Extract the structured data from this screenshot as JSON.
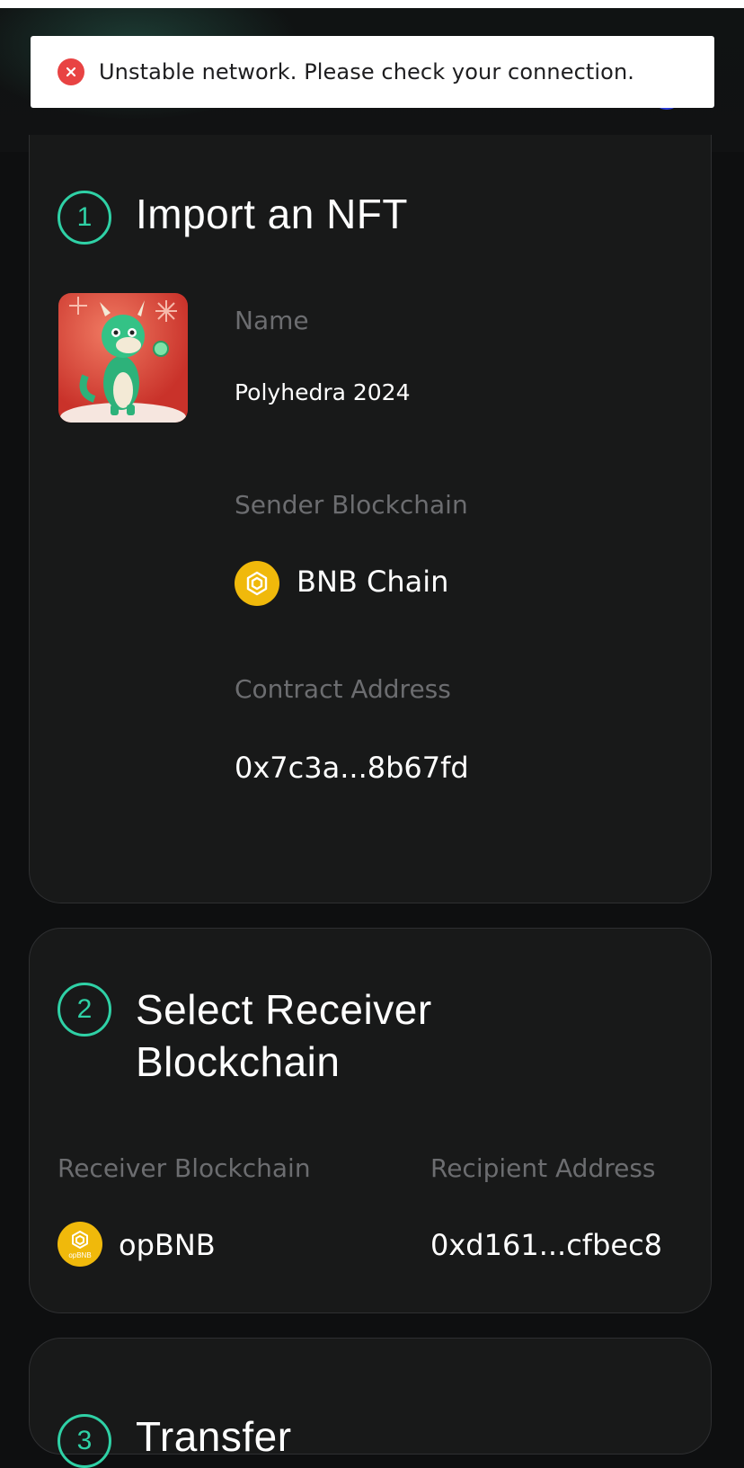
{
  "toast": {
    "message": "Unstable network. Please check your connection.",
    "icon": "close-circle-icon",
    "color": "#e84343"
  },
  "step1": {
    "number": "1",
    "title": "Import an NFT",
    "name_label": "Name",
    "name_value": "Polyhedra 2024",
    "sender_label": "Sender Blockchain",
    "sender_value": "BNB Chain",
    "contract_label": "Contract Address",
    "contract_value": "0x7c3a...8b67fd"
  },
  "step2": {
    "number": "2",
    "title_line1": "Select Receiver",
    "title_line2": "Blockchain",
    "receiver_label": "Receiver Blockchain",
    "receiver_value": "opBNB",
    "recipient_label": "Recipient Address",
    "recipient_value": "0xd161...cfbec8",
    "opbnb_icon_text": "opBNB"
  },
  "step3": {
    "number": "3",
    "title": "Transfer"
  },
  "colors": {
    "accent": "#2fd1a6",
    "bnb": "#f0b90b",
    "background": "#0e0f10",
    "card": "#181919"
  }
}
